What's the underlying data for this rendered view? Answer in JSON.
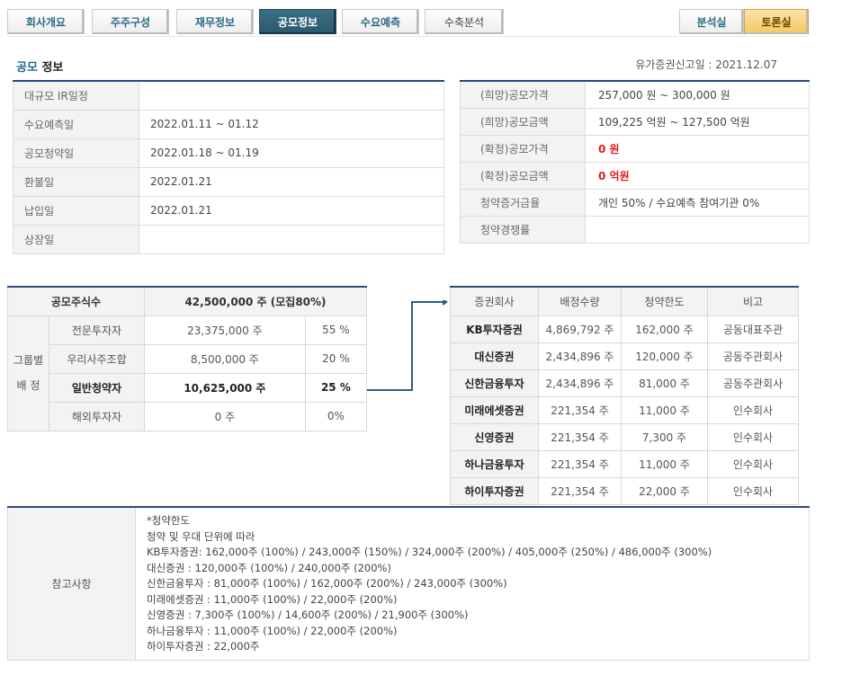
{
  "tabs": [
    "회사개요",
    "주주구성",
    "재무정보",
    "공모정보",
    "수요예측",
    "수축분석"
  ],
  "side_tabs": [
    "분석실",
    "토론실"
  ],
  "section": {
    "title_hl": "공모",
    "title_rest": " 정보",
    "filed": "유가증권신고일 : 2021.12.07"
  },
  "schedule": [
    {
      "label": "대규모 IR일정",
      "value": ""
    },
    {
      "label": "수요예측일",
      "value": "2022.01.11 ~ 01.12"
    },
    {
      "label": "공모청약일",
      "value": "2022.01.18 ~ 01.19"
    },
    {
      "label": "환불일",
      "value": "2022.01.21"
    },
    {
      "label": "납입일",
      "value": "2022.01.21"
    },
    {
      "label": "상장일",
      "value": ""
    }
  ],
  "price": [
    {
      "label": "(희망)공모가격",
      "value": "257,000 원 ~ 300,000 원"
    },
    {
      "label": "(희망)공모금액",
      "value": "109,225 억원   ~ 127,500 억원"
    },
    {
      "label": "(확정)공모가격",
      "value": "0 원"
    },
    {
      "label": "(확정)공모금액",
      "value": "0 억원"
    },
    {
      "label": "청약증거금율",
      "value": "개인 50% / 수요예측 참여기관 0%"
    },
    {
      "label": "청약경쟁률",
      "value": ""
    }
  ],
  "distribution": {
    "total_label": "공모주식수",
    "total_value": "42,500,000 주 (모집80%)",
    "group_label_1": "그룹별",
    "group_label_2": "배 정",
    "rows": [
      {
        "label": "전문투자자",
        "shares": "23,375,000 주",
        "pct": "55 %"
      },
      {
        "label": "우리사주조합",
        "shares": "8,500,000 주",
        "pct": "20 %"
      },
      {
        "label": "일반청약자",
        "shares": "10,625,000 주",
        "pct": "25 %"
      },
      {
        "label": "해외투자자",
        "shares": "0 주",
        "pct": "0%"
      }
    ]
  },
  "brokers": {
    "headers": [
      "증권회사",
      "배정수량",
      "청약한도",
      "비고"
    ],
    "rows": [
      {
        "name": "KB투자증권",
        "qty": "4,869,792 주",
        "limit": "162,000 주",
        "note": "공동대표주관"
      },
      {
        "name": "대신증권",
        "qty": "2,434,896 주",
        "limit": "120,000 주",
        "note": "공동주관회사"
      },
      {
        "name": "신한금융투자",
        "qty": "2,434,896 주",
        "limit": "81,000 주",
        "note": "공동주관회사"
      },
      {
        "name": "미래에셋증권",
        "qty": "221,354 주",
        "limit": "11,000 주",
        "note": "인수회사"
      },
      {
        "name": "신영증권",
        "qty": "221,354 주",
        "limit": "7,300 주",
        "note": "인수회사"
      },
      {
        "name": "하나금융투자",
        "qty": "221,354 주",
        "limit": "11,000 주",
        "note": "인수회사"
      },
      {
        "name": "하이투자증권",
        "qty": "221,354 주",
        "limit": "22,000 주",
        "note": "인수회사"
      }
    ]
  },
  "notes": {
    "label": "참고사항",
    "lines": [
      "*청약한도",
      "청약 및 우대 단위에 따라",
      "KB투자증권: 162,000주 (100%) / 243,000주 (150%) / 324,000주 (200%) / 405,000주 (250%) / 486,000주 (300%)",
      "대신증권 : 120,000주 (100%) / 240,000주 (200%)",
      "신한금융투자 : 81,000주 (100%) / 162,000주 (200%) / 243,000주 (300%)",
      "미래에셋증권 : 11,000주 (100%) / 22,000주 (200%)",
      "신영증권 : 7,300주 (100%) / 14,600주 (200%) / 21,900주 (300%)",
      "하나금융투자 : 11,000주 (100%) / 22,000주 (200%)",
      "하이투자증권 : 22,000주"
    ]
  }
}
